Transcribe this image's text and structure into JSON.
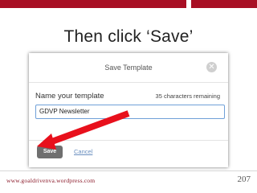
{
  "slide": {
    "title": "Then click ‘Save’",
    "footer_url": "www.goaldrivenva.wordpress.com",
    "page_number": "207",
    "accent_color": "#a80f24"
  },
  "dialog": {
    "title": "Save Template",
    "close_icon": "close-icon",
    "name_label": "Name your template",
    "chars_remaining": "35 characters remaining",
    "input_value": "GDVP Newsletter",
    "save_label": "Save",
    "cancel_label": "Cancel"
  },
  "annotation": {
    "arrow_color": "#e8101c",
    "arrow_icon": "red-arrow-icon"
  }
}
